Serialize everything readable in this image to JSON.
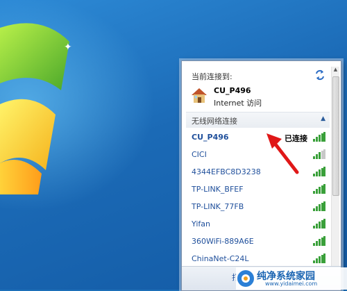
{
  "flyout": {
    "current_label": "当前连接到:",
    "current_network": "CU_P496",
    "current_status": "Internet 访问",
    "section_label": "无线网络连接",
    "networks": [
      {
        "name": "CU_P496",
        "status": "已连接",
        "signal": "strong"
      },
      {
        "name": "CICI",
        "status": "",
        "signal": "weak"
      },
      {
        "name": "4344EFBC8D3238",
        "status": "",
        "signal": "strong"
      },
      {
        "name": "TP-LINK_BFEF",
        "status": "",
        "signal": "strong"
      },
      {
        "name": "TP-LINK_77FB",
        "status": "",
        "signal": "strong"
      },
      {
        "name": "Yifan",
        "status": "",
        "signal": "strong"
      },
      {
        "name": "360WiFi-889A6E",
        "status": "",
        "signal": "strong"
      },
      {
        "name": "ChinaNet-C24L",
        "status": "",
        "signal": "strong"
      }
    ],
    "footer_link": "打开"
  },
  "watermark": {
    "title": "纯净系统家园",
    "url": "www.yidaimei.com"
  },
  "colors": {
    "link": "#1f4f9b",
    "signal": "#3aa03a",
    "arrow": "#e01818"
  }
}
